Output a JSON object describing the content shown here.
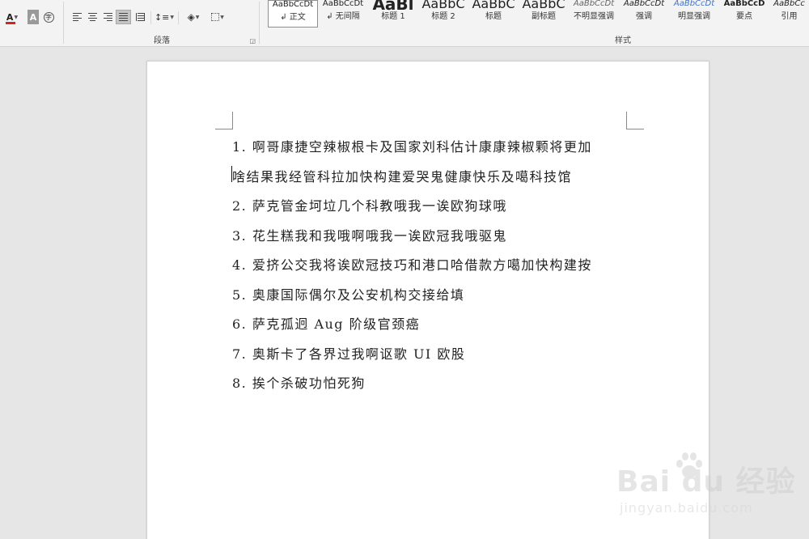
{
  "ribbon": {
    "paragraph_group_label": "段落",
    "styles_group_label": "样式",
    "font_color_letter": "A",
    "highlight_letter": "A"
  },
  "styles": [
    {
      "preview": "AaBbCcDt",
      "name": "↲ 正文"
    },
    {
      "preview": "AaBbCcDt",
      "name": "↲ 无间隔"
    },
    {
      "preview": "AaBl",
      "name": "标题 1"
    },
    {
      "preview": "AaBbC",
      "name": "标题 2"
    },
    {
      "preview": "AaBbC",
      "name": "标题"
    },
    {
      "preview": "AaBbC",
      "name": "副标题"
    },
    {
      "preview": "AaBbCcDt",
      "name": "不明显强调"
    },
    {
      "preview": "AaBbCcDt",
      "name": "强调"
    },
    {
      "preview": "AaBbCcDt",
      "name": "明显强调"
    },
    {
      "preview": "AaBbCcD",
      "name": "要点"
    },
    {
      "preview": "AaBbCc",
      "name": "引用"
    }
  ],
  "document": {
    "lines": [
      "1. 啊哥康捷空辣椒根卡及国家刘科估计康康辣椒颗将更加",
      "啥结果我经管科拉加快构建爱哭鬼健康快乐及噶科技馆",
      "2. 萨克管金坷垃几个科教哦我一诶欧狗球哦",
      "3. 花生糕我和我哦啊哦我一诶欧冠我哦驱鬼",
      "4. 爱挤公交我将诶欧冠技巧和港口哈借款方噶加快构建按",
      "5. 奥康国际偶尔及公安机构交接给填",
      "6. 萨克孤迥 Aug 阶级官颈癌",
      "7. 奥斯卡了各界过我啊讴歌 UI 欧股",
      "8. 挨个杀破功怕死狗"
    ]
  },
  "watermark": {
    "logo": "Bai du 经验",
    "url": "jingyan.baidu.com"
  },
  "colors": {
    "font_color_bar": "#d0261e",
    "spell_error": "#c0392b",
    "grammar_error": "#4a7bd0"
  }
}
